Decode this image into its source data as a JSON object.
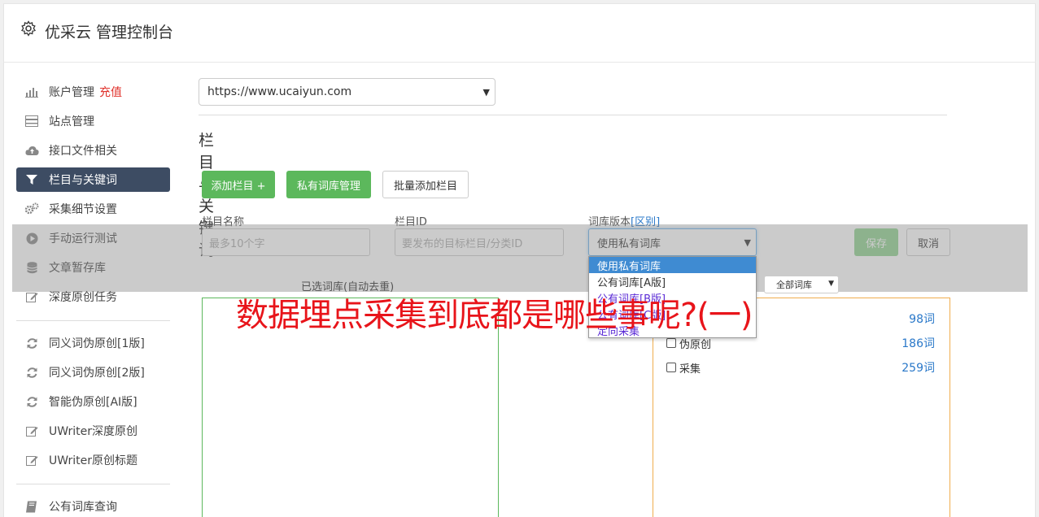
{
  "header": {
    "title": "优采云 管理控制台"
  },
  "sidebar": {
    "items": [
      {
        "label": "账户管理",
        "badge": "充值",
        "icon": "bar-chart-icon"
      },
      {
        "label": "站点管理",
        "icon": "server-icon"
      },
      {
        "label": "接口文件相关",
        "icon": "cloud-upload-icon"
      },
      {
        "label": "栏目与关键词",
        "icon": "filter-icon"
      },
      {
        "label": "采集细节设置",
        "icon": "cogs-icon"
      },
      {
        "label": "手动运行测试",
        "icon": "play-circle-icon"
      },
      {
        "label": "文章暂存库",
        "icon": "database-icon"
      },
      {
        "label": "深度原创任务",
        "icon": "edit-icon"
      },
      {
        "label": "同义词伪原创[1版]",
        "icon": "refresh-icon"
      },
      {
        "label": "同义词伪原创[2版]",
        "icon": "refresh-icon"
      },
      {
        "label": "智能伪原创[AI版]",
        "icon": "refresh-icon"
      },
      {
        "label": "UWriter深度原创",
        "icon": "edit-icon"
      },
      {
        "label": "UWriter原创标题",
        "icon": "edit-icon"
      },
      {
        "label": "公有词库查询",
        "icon": "book-icon"
      }
    ]
  },
  "main": {
    "site_select": "https://www.ucaiyun.com",
    "section_title": "栏目与关键词",
    "buttons": {
      "add_column": "添加栏目 +",
      "private_lib": "私有词库管理",
      "batch_add": "批量添加栏目",
      "save": "保存",
      "cancel": "取消"
    },
    "form": {
      "name_label": "栏目名称",
      "name_placeholder": "最多10个字",
      "id_label": "栏目ID",
      "id_placeholder": "要发布的目标栏目/分类ID",
      "version_label": "词库版本",
      "version_link": "[区别]",
      "version_value": "使用私有词库"
    },
    "dropdown_options": [
      "使用私有词库",
      "公有词库[A版]",
      "公有词库[B版]",
      "公有词库[C版]",
      "定向采集"
    ],
    "selected_label": "已选词库(自动去重)",
    "filter_select": "全部词库",
    "libraries": [
      {
        "name": "",
        "count": "98词"
      },
      {
        "name": "伪原创",
        "count": "186词"
      },
      {
        "name": "采集",
        "count": "259词"
      }
    ]
  },
  "banner": "数据埋点采集到底都是哪些事呢?(一)",
  "colors": {
    "accent_green": "#5cb85c",
    "active_nav": "#3d4c63",
    "banner_red": "#e8141a",
    "link_blue": "#2a78c9"
  }
}
